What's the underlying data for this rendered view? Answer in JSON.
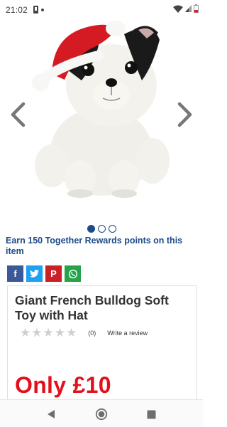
{
  "status_bar": {
    "time": "21:02",
    "icons": [
      "notification-icon",
      "dot-icon",
      "wifi-icon",
      "signal-icon",
      "battery-icon"
    ]
  },
  "gallery": {
    "image": "white-and-black-french-bulldog-plush-with-red-santa-hat",
    "prev_icon": "chevron-left-icon",
    "next_icon": "chevron-right-icon",
    "slide_count": 3,
    "active_slide": 1
  },
  "rewards": {
    "text": "Earn 150 Together Rewards points on this item"
  },
  "share": {
    "buttons": [
      {
        "icon": "facebook-icon",
        "glyph": "f",
        "color": "#3b5998"
      },
      {
        "icon": "twitter-icon",
        "glyph": "t",
        "color": "#1da1f2"
      },
      {
        "icon": "pinterest-icon",
        "glyph": "P",
        "color": "#cb2027"
      },
      {
        "icon": "whatsapp-icon",
        "glyph": "w",
        "color": "#25a34a"
      }
    ]
  },
  "product": {
    "title": "Giant French Bulldog Soft Toy with Hat",
    "rating_stars": 0,
    "review_count": "(0)",
    "write_review": "Write a review",
    "price": "Only £10"
  },
  "colors": {
    "brand_blue": "#1c4a8a",
    "price_red": "#e3101b"
  },
  "nav_bar": {
    "icons": [
      "back-icon",
      "home-icon",
      "recents-icon"
    ]
  }
}
